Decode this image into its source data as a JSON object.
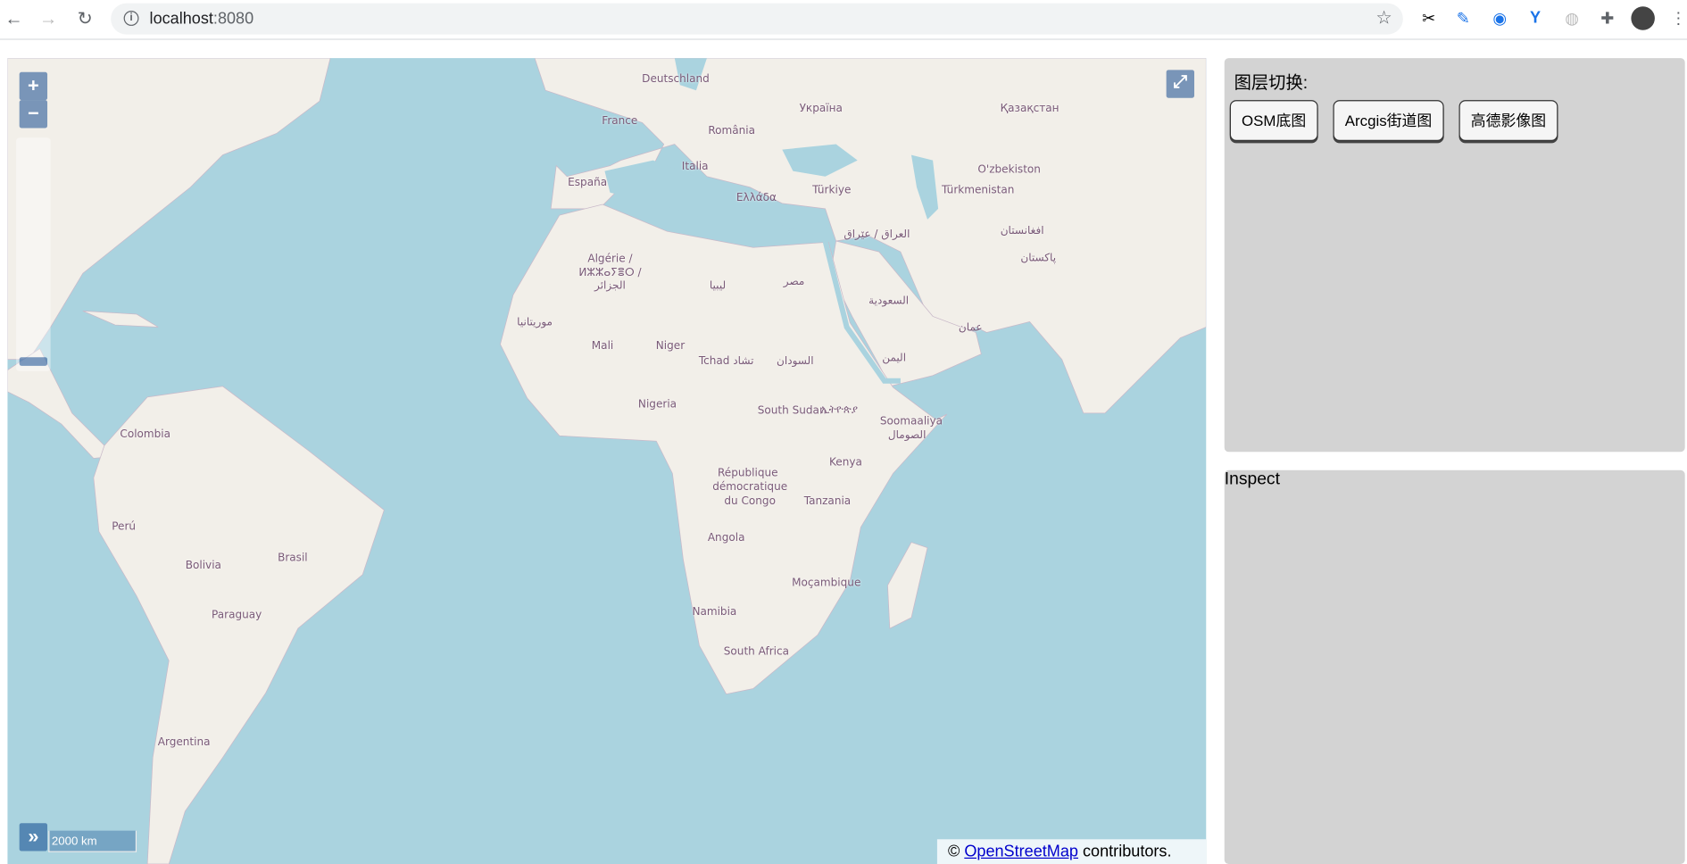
{
  "browser": {
    "url_host": "localhost",
    "url_port": ":8080"
  },
  "map": {
    "labels": [
      "Deutschland",
      "France",
      "Україна",
      "Қазақстан",
      "România",
      "Italia",
      "España",
      "Ελλάδα",
      "Türkiye",
      "O'zbekiston",
      "Türkmenistan",
      "افغانستان",
      "پاکستان",
      "العراق / عێراق",
      "Algérie /",
      "ⵍⵣⵣⴰⵢⴻⵔ /",
      "الجزائر",
      "ليبيا",
      "مصر",
      "السعودية",
      "موريتانيا",
      "Mali",
      "Niger",
      "Tchad تشاد",
      "السودان",
      "عمان",
      "اليمن",
      "Nigeria",
      "South Sudan",
      "ኢትዮጵያ",
      "Soomaaliya",
      "الصومال",
      "Colombia",
      "Kenya",
      "République",
      "démocratique",
      "du Congo",
      "Tanzania",
      "Perú",
      "Brasil",
      "Bolivia",
      "Angola",
      "Paraguay",
      "Moçambique",
      "Namibia",
      "South Africa",
      "Argentina"
    ],
    "zoom_in": "+",
    "zoom_out": "−",
    "fullscreen_icon": "⤢",
    "overview_icon": "»",
    "scale": "2000 km",
    "attribution": {
      "prefix": "©",
      "link": "OpenStreetMap",
      "suffix": "contributors."
    },
    "colors": {
      "water": "#aad3df",
      "land": "#f2efe9"
    }
  },
  "layer_panel": {
    "title": "图层切换:",
    "buttons": [
      "OSM底图",
      "Arcgis街道图",
      "高德影像图"
    ]
  },
  "inspect_panel": {
    "title": "Inspect"
  }
}
